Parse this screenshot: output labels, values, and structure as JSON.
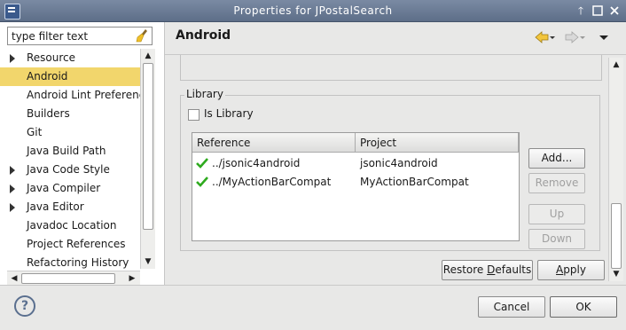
{
  "window": {
    "title": "Properties for JPostalSearch",
    "controls": [
      "up-arrow-icon",
      "maximize-icon",
      "close-icon"
    ]
  },
  "filter": {
    "value": "type filter text",
    "placeholder": "type filter text"
  },
  "tree": {
    "items": [
      {
        "label": "Resource",
        "expandable": true,
        "selected": false
      },
      {
        "label": "Android",
        "expandable": false,
        "selected": true
      },
      {
        "label": "Android Lint Preferences",
        "expandable": false,
        "selected": false
      },
      {
        "label": "Builders",
        "expandable": false,
        "selected": false
      },
      {
        "label": "Git",
        "expandable": false,
        "selected": false
      },
      {
        "label": "Java Build Path",
        "expandable": false,
        "selected": false
      },
      {
        "label": "Java Code Style",
        "expandable": true,
        "selected": false
      },
      {
        "label": "Java Compiler",
        "expandable": true,
        "selected": false
      },
      {
        "label": "Java Editor",
        "expandable": true,
        "selected": false
      },
      {
        "label": "Javadoc Location",
        "expandable": false,
        "selected": false
      },
      {
        "label": "Project References",
        "expandable": false,
        "selected": false
      },
      {
        "label": "Refactoring History",
        "expandable": false,
        "selected": false
      }
    ]
  },
  "page": {
    "title": "Android",
    "nav": [
      "back-icon",
      "dropdown-icon",
      "forward-icon",
      "dropdown-icon",
      "view-menu-icon"
    ]
  },
  "library": {
    "group_label": "Library",
    "is_library_label": "Is Library",
    "is_library_checked": false,
    "columns": [
      "Reference",
      "Project"
    ],
    "rows": [
      {
        "reference": "../jsonic4android",
        "project": "jsonic4android",
        "status_icon": "check-icon"
      },
      {
        "reference": "../MyActionBarCompat",
        "project": "MyActionBarCompat",
        "status_icon": "check-icon"
      }
    ],
    "buttons": {
      "add": "Add...",
      "remove": "Remove",
      "up": "Up",
      "down": "Down"
    }
  },
  "page_buttons": {
    "restore_prefix": "Restore ",
    "restore_mnemonic": "D",
    "restore_suffix": "efaults",
    "apply_mnemonic": "A",
    "apply_suffix": "pply"
  },
  "dialog_buttons": {
    "cancel": "Cancel",
    "ok": "OK"
  },
  "colors": {
    "selection": "#f2d66c",
    "titlebar": "#6d7d97",
    "check": "#2eaa1e"
  }
}
